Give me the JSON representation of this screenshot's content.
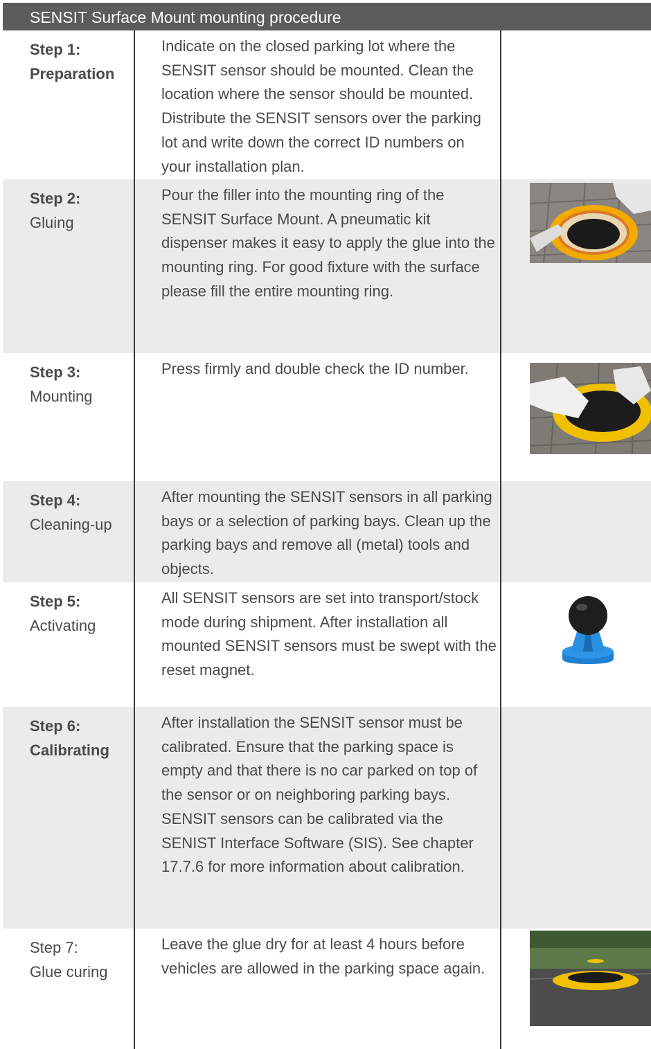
{
  "title": "SENSIT Surface Mount mounting procedure",
  "steps": [
    {
      "num": "Step 1:",
      "name": "Preparation",
      "text": [
        "Indicate on the closed parking lot where the SENSIT sensor should be mounted. Clean the location where the sensor should be mounted. Distribute the SENSIT sensors over the parking lot and write down the correct ID numbers on your installation plan."
      ]
    },
    {
      "num": "Step 2:",
      "name": "Gluing",
      "text": [
        "Pour the filler into the mounting ring of the SENSIT Surface Mount. A pneumatic kit dispenser makes it easy to apply the glue into the mounting ring. For good fixture with the surface please fill the entire mounting ring."
      ],
      "image": "gluing-photo"
    },
    {
      "num": "Step 3:",
      "name": "Mounting",
      "text": [
        "Press firmly and double check the ID number."
      ],
      "image": "mounting-photo"
    },
    {
      "num": "Step 4:",
      "name": "Cleaning-up",
      "text": [
        "After mounting the SENSIT sensors in all parking bays or a selection of parking bays. Clean up the parking bays and remove all (metal) tools and objects."
      ]
    },
    {
      "num": "Step 5:",
      "name": "Activating",
      "text": [
        "All SENSIT sensors are set into transport/stock mode during shipment. After installation all mounted SENSIT sensors must be swept with the reset magnet."
      ],
      "image": "reset-magnet-photo"
    },
    {
      "num": "Step 6:",
      "name": "Calibrating",
      "text": [
        "After installation the SENSIT sensor must be calibrated. Ensure that the parking space is empty and that there is no car parked on top of the sensor or on neighboring parking bays.",
        "SENSIT sensors can be calibrated via the SENIST Interface Software (SIS). See chapter 17.7.6 for more information about calibration."
      ]
    },
    {
      "num": "Step 7:",
      "name": "Glue curing",
      "text": [
        "Leave the glue dry for at least 4 hours before vehicles are allowed in the parking space again."
      ],
      "image": "curing-photo"
    }
  ],
  "colors": {
    "header_bg": "#5c5c5c",
    "shaded_row": "#ebebeb",
    "text": "#4a4a4a"
  }
}
